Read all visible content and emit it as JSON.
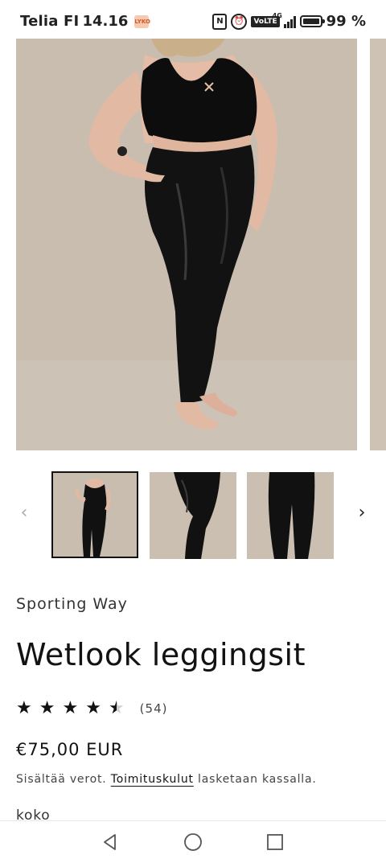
{
  "status_bar": {
    "carrier": "Telia FI",
    "time": "14.16",
    "badge": "LYKO",
    "network": "4G",
    "volte": "VoLTE",
    "battery_percent_text": "99 %",
    "battery_level": 0.99
  },
  "gallery": {
    "prev_label": "‹",
    "next_label": "›",
    "thumbnails": [
      {
        "alt": "front view",
        "active": true
      },
      {
        "alt": "legs side view",
        "active": false
      },
      {
        "alt": "legs back view",
        "active": false
      }
    ]
  },
  "product": {
    "vendor": "Sporting Way",
    "title": "Wetlook leggingsit",
    "rating": 4.5,
    "review_count": "(54)",
    "price": "€75,00 EUR",
    "tax_prefix": "Sisältää verot.",
    "shipping_link": "Toimituskulut",
    "tax_suffix": "lasketaan kassalla.",
    "size_label": "koko"
  },
  "nav": {
    "back_icon": "triangle-back-icon",
    "home_icon": "circle-home-icon",
    "recents_icon": "square-recents-icon"
  }
}
